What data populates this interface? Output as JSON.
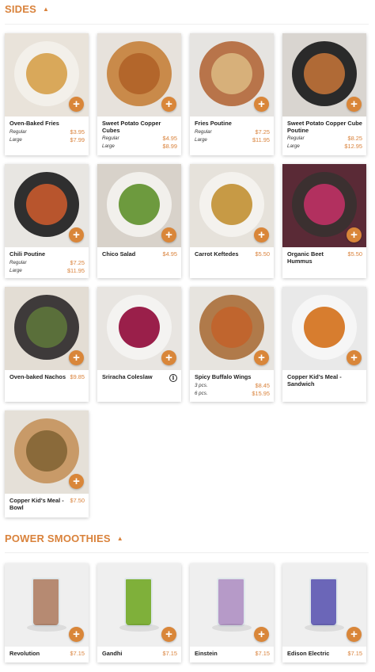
{
  "sections": [
    {
      "title": "SIDES",
      "items": [
        {
          "name": "Oven-Baked Fries",
          "options": [
            {
              "label": "Regular",
              "price": "$3.95"
            },
            {
              "label": "Large",
              "price": "$7.99"
            }
          ],
          "bg": "#e9e3da",
          "plate": "#f3f0ea",
          "food": "#d9a85a"
        },
        {
          "name": "Sweet Potato Copper Cubes",
          "options": [
            {
              "label": "Regular",
              "price": "$4.95"
            },
            {
              "label": "Large",
              "price": "$8.99"
            }
          ],
          "bg": "#e7e2dc",
          "plate": "#c98a4a",
          "food": "#b3662b"
        },
        {
          "name": "Fries Poutine",
          "options": [
            {
              "label": "Regular",
              "price": "$7.25"
            },
            {
              "label": "Large",
              "price": "$11.95"
            }
          ],
          "bg": "#e6e4e1",
          "plate": "#b8744a",
          "food": "#d7b07a"
        },
        {
          "name": "Sweet Potato Copper Cube Poutine",
          "options": [
            {
              "label": "Regular",
              "price": "$8.25"
            },
            {
              "label": "Large",
              "price": "$12.95"
            }
          ],
          "bg": "#d9d5d0",
          "plate": "#2a2a2a",
          "food": "#b06a36"
        },
        {
          "name": "Chili Poutine",
          "options": [
            {
              "label": "Regular",
              "price": "$7.25"
            },
            {
              "label": "Large",
              "price": "$11.95"
            }
          ],
          "bg": "#e8e6e2",
          "plate": "#2f2f2f",
          "food": "#b8552d"
        },
        {
          "name": "Chico Salad",
          "price": "$4.95",
          "bg": "#d8d2ca",
          "plate": "#f2f0ec",
          "food": "#6d9a3e"
        },
        {
          "name": "Carrot Keftedes",
          "price": "$5.50",
          "bg": "#e6e2db",
          "plate": "#f4f2ee",
          "food": "#c79a45"
        },
        {
          "name": "Organic Beet Hummus",
          "price": "$5.50",
          "bg": "#5a2a36",
          "plate": "#3b3030",
          "food": "#b2305f"
        },
        {
          "name": "Oven-baked Nachos",
          "price": "$9.85",
          "bg": "#e3ddd4",
          "plate": "#3e3a3a",
          "food": "#5a6f3a"
        },
        {
          "name": "Sriracha Coleslaw",
          "price": "",
          "info": "i",
          "bg": "#e8e5e1",
          "plate": "#f4f3f1",
          "food": "#9a1f4a"
        },
        {
          "name": "Spicy Buffalo Wings",
          "options": [
            {
              "label": "3 pcs.",
              "price": "$8.45"
            },
            {
              "label": "6 pcs.",
              "price": "$15.95"
            }
          ],
          "bg": "#e7e4df",
          "plate": "#b07a4a",
          "food": "#c0652e"
        },
        {
          "name": "Copper Kid's Meal - Sandwich",
          "price": "",
          "bg": "#e9e9e9",
          "plate": "#f6f6f6",
          "food": "#d77d2f"
        },
        {
          "name": "Copper Kid's Meal - Bowl",
          "price": "$7.50",
          "bg": "#e5e0d8",
          "plate": "#c89a68",
          "food": "#8a6a3a"
        }
      ]
    },
    {
      "title": "POWER SMOOTHIES",
      "items": [
        {
          "name": "Revolution",
          "price": "$7.15",
          "bg": "#efefef",
          "plate": "#ffffff",
          "food": "#b68a72"
        },
        {
          "name": "Gandhi",
          "price": "$7.15",
          "bg": "#efefef",
          "plate": "#ffffff",
          "food": "#7fb03a"
        },
        {
          "name": "Einstein",
          "price": "$7.15",
          "bg": "#efefef",
          "plate": "#ffffff",
          "food": "#b69ac8"
        },
        {
          "name": "Edison Electric",
          "price": "$7.15",
          "bg": "#efefef",
          "plate": "#ffffff",
          "food": "#6b66b8"
        }
      ]
    }
  ],
  "add_icon": "plus-icon",
  "caret_icon": "caret-up-icon",
  "colors": {
    "accent": "#d9823b",
    "button": "#d98639"
  }
}
